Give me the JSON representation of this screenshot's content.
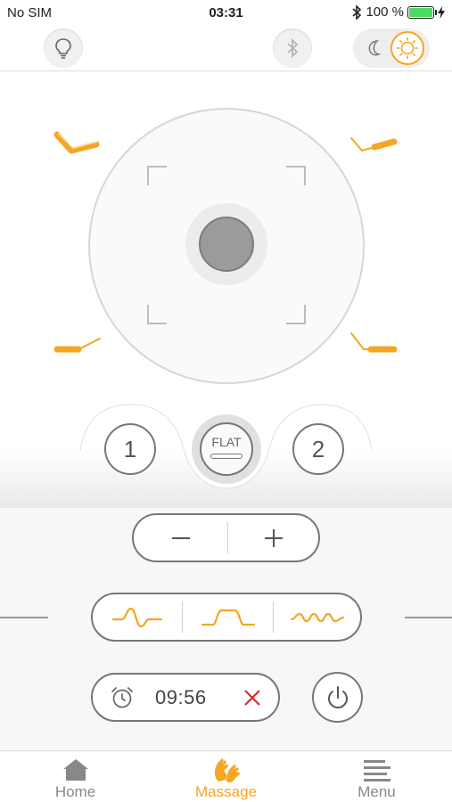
{
  "status_bar": {
    "carrier": "No SIM",
    "time": "03:31",
    "battery": "100 %"
  },
  "presets": {
    "preset1": "1",
    "flat": "FLAT",
    "preset2": "2"
  },
  "timer": {
    "value": "09:56"
  },
  "tabs": [
    {
      "label": "Home"
    },
    {
      "label": "Massage"
    },
    {
      "label": "Menu"
    }
  ],
  "colors": {
    "accent": "#f6a623",
    "outline": "#777777",
    "cancel": "#d0302f"
  }
}
